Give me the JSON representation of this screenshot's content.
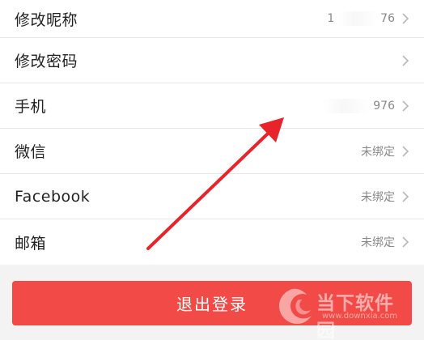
{
  "settings": {
    "items": [
      {
        "label": "修改昵称",
        "value": "1",
        "value_suffix": "76"
      },
      {
        "label": "修改密码",
        "value": ""
      },
      {
        "label": "手机",
        "value": "",
        "value_suffix": "976"
      },
      {
        "label": "微信",
        "value": "未绑定"
      },
      {
        "label": "Facebook",
        "value": "未绑定"
      },
      {
        "label": "邮箱",
        "value": "未绑定"
      }
    ]
  },
  "logout": {
    "label": "退出登录"
  },
  "watermark": {
    "title": "当下软件园",
    "url": "www.downxia.com"
  },
  "colors": {
    "accent": "#f24b47",
    "arrow": "#e8242a",
    "background": "#f3f3f3"
  },
  "icons": {
    "chevron": "chevron-right-icon",
    "watermark_logo": "downxia-logo-icon"
  }
}
